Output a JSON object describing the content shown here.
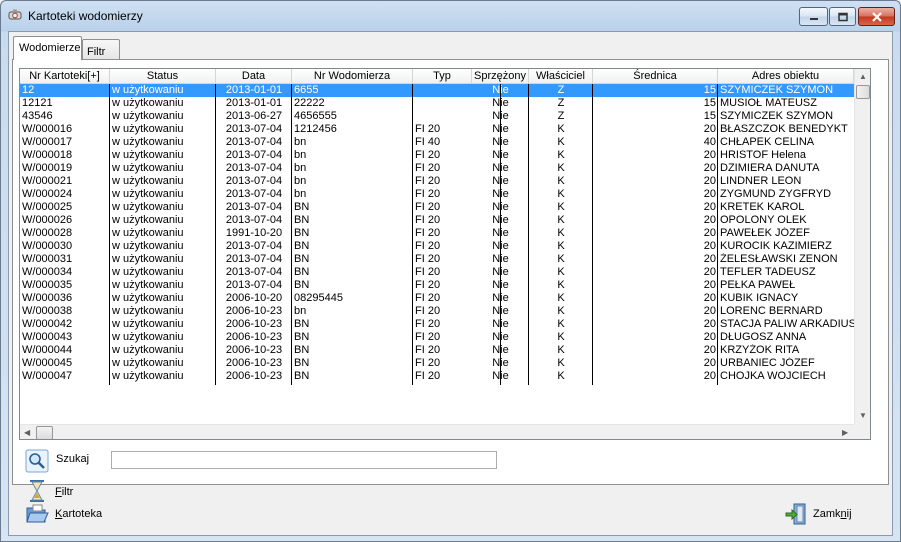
{
  "window": {
    "title": "Kartoteki wodomierzy"
  },
  "tabs": [
    {
      "label": "Wodomierze"
    },
    {
      "label": "Filtr"
    }
  ],
  "grid": {
    "columns": [
      "Nr Kartoteki[+]",
      "Status",
      "Data",
      "Nr Wodomierza",
      "Typ",
      "Sprzężony",
      "Właściciel",
      "Średnica",
      "Adres obiektu"
    ],
    "rows": [
      [
        "12",
        "w użytkowaniu",
        "2013-01-01",
        "6655",
        "",
        "Nie",
        "Z",
        "15",
        "SZYMICZEK SZYMON"
      ],
      [
        "12121",
        "w użytkowaniu",
        "2013-01-01",
        "22222",
        "",
        "Nie",
        "Z",
        "15",
        "MUSIOŁ MATEUSZ"
      ],
      [
        "43546",
        "w użytkowaniu",
        "2013-06-27",
        "4656555",
        "",
        "Nie",
        "Z",
        "15",
        "SZYMICZEK SZYMON"
      ],
      [
        "W/000016",
        "w użytkowaniu",
        "2013-07-04",
        "1212456",
        "FI 20",
        "Nie",
        "K",
        "20",
        "BŁASZCZOK BENEDYKT"
      ],
      [
        "W/000017",
        "w użytkowaniu",
        "2013-07-04",
        "bn",
        "FI 40",
        "Nie",
        "K",
        "40",
        "CHŁAPEK CELINA"
      ],
      [
        "W/000018",
        "w użytkowaniu",
        "2013-07-04",
        "bn",
        "FI 20",
        "Nie",
        "K",
        "20",
        "HRISTOF Helena"
      ],
      [
        "W/000019",
        "w użytkowaniu",
        "2013-07-04",
        "bn",
        "FI 20",
        "Nie",
        "K",
        "20",
        "DZIMIERA DANUTA"
      ],
      [
        "W/000021",
        "w użytkowaniu",
        "2013-07-04",
        "bn",
        "FI 20",
        "Nie",
        "K",
        "20",
        "LINDNER LEON"
      ],
      [
        "W/000024",
        "w użytkowaniu",
        "2013-07-04",
        "bn",
        "FI 20",
        "Nie",
        "K",
        "20",
        "ZYGMUND ZYGFRYD"
      ],
      [
        "W/000025",
        "w użytkowaniu",
        "2013-07-04",
        "BN",
        "FI 20",
        "Nie",
        "K",
        "20",
        "KRETEK KAROL"
      ],
      [
        "W/000026",
        "w użytkowaniu",
        "2013-07-04",
        "BN",
        "FI 20",
        "Nie",
        "K",
        "20",
        "OPOLONY OLEK"
      ],
      [
        "W/000028",
        "w użytkowaniu",
        "1991-10-20",
        "BN",
        "FI 20",
        "Nie",
        "K",
        "20",
        "PAWEŁEK JÓZEF"
      ],
      [
        "W/000030",
        "w użytkowaniu",
        "2013-07-04",
        "BN",
        "FI 20",
        "Nie",
        "K",
        "20",
        "KUROCIK KAZIMIERZ"
      ],
      [
        "W/000031",
        "w użytkowaniu",
        "2013-07-04",
        "BN",
        "FI 20",
        "Nie",
        "K",
        "20",
        "ŻELESŁAWSKI ZENON"
      ],
      [
        "W/000034",
        "w użytkowaniu",
        "2013-07-04",
        "BN",
        "FI 20",
        "Nie",
        "K",
        "20",
        "TEFLER TADEUSZ"
      ],
      [
        "W/000035",
        "w użytkowaniu",
        "2013-07-04",
        "BN",
        "FI 20",
        "Nie",
        "K",
        "20",
        "PEŁKA PAWEŁ"
      ],
      [
        "W/000036",
        "w użytkowaniu",
        "2006-10-20",
        "08295445",
        "FI 20",
        "Nie",
        "K",
        "20",
        "KUBIK IGNACY"
      ],
      [
        "W/000038",
        "w użytkowaniu",
        "2006-10-23",
        "bn",
        "FI 20",
        "Nie",
        "K",
        "20",
        "LORENC BERNARD"
      ],
      [
        "W/000042",
        "w użytkowaniu",
        "2006-10-23",
        "BN",
        "FI 20",
        "Nie",
        "K",
        "20",
        "STACJA PALIW ARKADIUSZ"
      ],
      [
        "W/000043",
        "w użytkowaniu",
        "2006-10-23",
        "BN",
        "FI 20",
        "Nie",
        "K",
        "20",
        "DŁUGOSZ ANNA"
      ],
      [
        "W/000044",
        "w użytkowaniu",
        "2006-10-23",
        "BN",
        "FI 20",
        "Nie",
        "K",
        "20",
        "KRZYŻOK RITA"
      ],
      [
        "W/000045",
        "w użytkowaniu",
        "2006-10-23",
        "BN",
        "FI 20",
        "Nie",
        "K",
        "20",
        "URBANIEC JÓZEF"
      ],
      [
        "W/000047",
        "w użytkowaniu",
        "2006-10-23",
        "BN",
        "FI 20",
        "Nie",
        "K",
        "20",
        "CHOJKA WOJCIECH"
      ]
    ],
    "selected_row": 0
  },
  "search": {
    "label": "Szukaj",
    "value": ""
  },
  "filter": {
    "label": "Filtr"
  },
  "buttons": {
    "kartoteka": "Kartoteka",
    "zamknij": "Zamknij"
  },
  "colors": {
    "selection": "#3399ff",
    "titlebar": "#b9d1ea"
  },
  "icons": {
    "app": "meter-app-icon",
    "search": "magnifier-icon",
    "filter": "hourglass-icon",
    "kartoteka": "open-folder-icon",
    "zamknij": "exit-door-icon"
  }
}
